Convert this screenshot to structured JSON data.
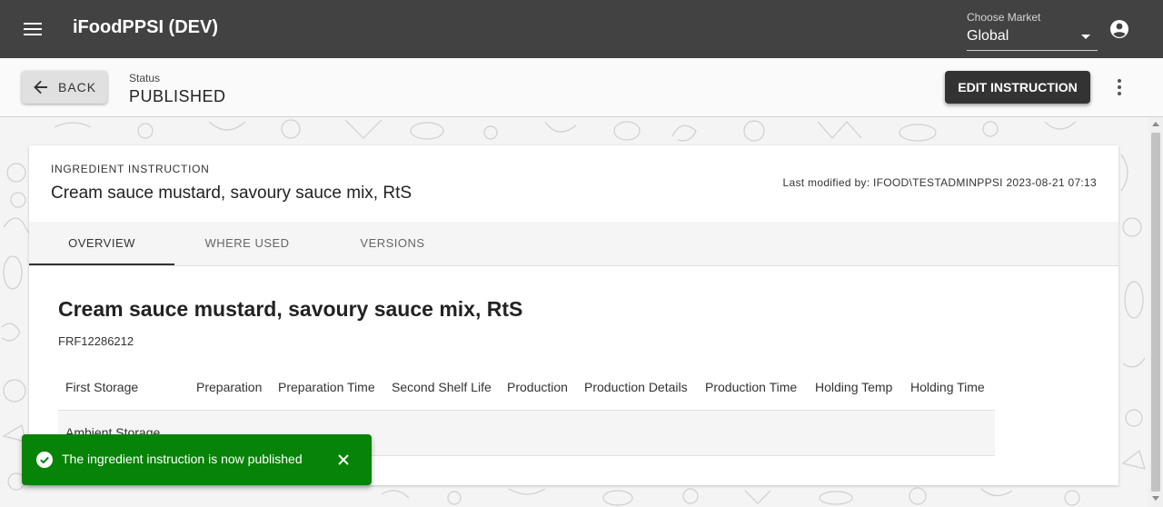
{
  "appbar": {
    "title": "iFoodPPSI (DEV)",
    "menu_icon": "menu-icon",
    "market_label": "Choose Market",
    "market_value": "Global",
    "account_icon": "account-circle-icon"
  },
  "statusbar": {
    "back_label": "BACK",
    "status_label": "Status",
    "status_value": "PUBLISHED",
    "edit_label": "EDIT INSTRUCTION"
  },
  "card": {
    "type": "INGREDIENT INSTRUCTION",
    "title": "Cream sauce mustard, savoury sauce mix, RtS",
    "last_modified": "Last modified by: IFOOD\\TESTADMINPPSI 2023-08-21 07:13",
    "tabs": [
      {
        "label": "OVERVIEW",
        "active": true
      },
      {
        "label": "WHERE USED",
        "active": false
      },
      {
        "label": "VERSIONS",
        "active": false
      }
    ],
    "content_title": "Cream sauce mustard, savoury sauce mix, RtS",
    "code": "FRF12286212",
    "table": {
      "headers": [
        "First Storage",
        "Preparation",
        "Preparation Time",
        "Second Shelf Life",
        "Production",
        "Production Details",
        "Production Time",
        "Holding Temp",
        "Holding Time"
      ],
      "rows": [
        [
          "Ambient Storage",
          "",
          "",
          "",
          "",
          "",
          "",
          "",
          ""
        ]
      ]
    }
  },
  "snackbar": {
    "message": "The ingredient instruction is now published",
    "color": "#078307"
  },
  "colors": {
    "appbar": "#424242",
    "primary_button": "#333333"
  }
}
